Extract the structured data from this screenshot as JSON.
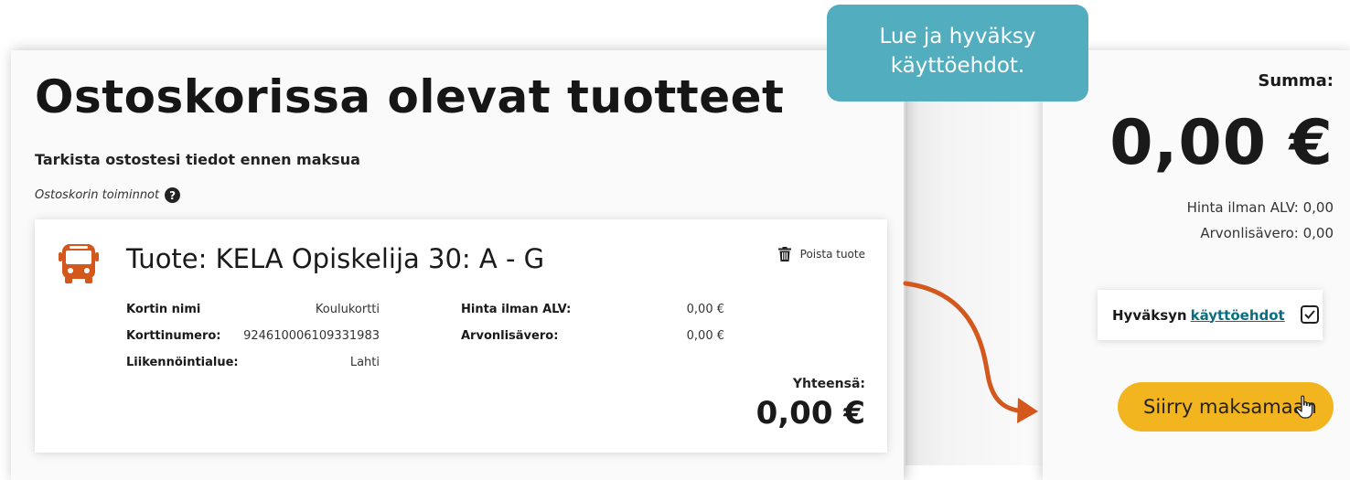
{
  "page": {
    "title": "Ostoskorissa olevat tuotteet",
    "subtitle": "Tarkista ostostesi tiedot ennen maksua",
    "cart_actions_label": "Ostoskorin toiminnot"
  },
  "product": {
    "title": "Tuote: KELA Opiskelija 30: A - G",
    "remove_label": "Poista tuote",
    "icon": "bus-icon",
    "fields_left": [
      {
        "label": "Kortin nimi",
        "value": "Koulukortti"
      },
      {
        "label": "Korttinumero:",
        "value": "924610006109331983"
      },
      {
        "label": "Liikennöintialue:",
        "value": "Lahti"
      }
    ],
    "fields_right": [
      {
        "label": "Hinta ilman ALV:",
        "value": "0,00 €"
      },
      {
        "label": "Arvonlisävero:",
        "value": "0,00 €"
      }
    ],
    "total_label": "Yhteensä:",
    "total_value": "0,00 €"
  },
  "summary": {
    "sum_label": "Summa:",
    "sum_value": "0,00 €",
    "price_without_vat": "Hinta ilman ALV: 0,00",
    "vat": "Arvonlisävero: 0,00",
    "accept_prefix": "Hyväksyn",
    "accept_link": "käyttöehdot",
    "accept_checked": true,
    "pay_button": "Siirry maksamaan"
  },
  "tooltip": {
    "line1": "Lue ja hyväksy",
    "line2": "käyttöehdot."
  },
  "colors": {
    "accent_orange": "#d4571c",
    "button_yellow": "#f2b51f",
    "tooltip_teal": "#52adbf",
    "link_teal": "#0a6e80"
  }
}
